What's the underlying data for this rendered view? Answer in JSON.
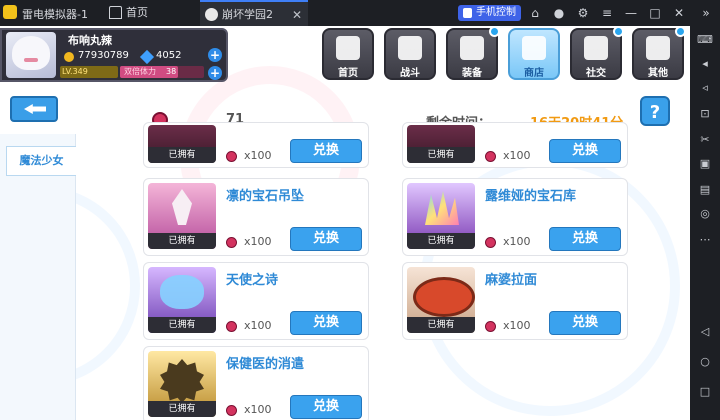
{
  "emulator": {
    "app_title": "雷电模拟器-1",
    "tabs": [
      {
        "label": "首页"
      },
      {
        "label": "崩坏学园2"
      }
    ],
    "phone_control": "手机控制"
  },
  "player": {
    "name": "布响丸辣",
    "coins": "77930789",
    "gems": "4052",
    "level": "LV.349",
    "stamina_label": "双倍体力",
    "stamina_value": "38"
  },
  "nav": [
    {
      "label": "首页",
      "icon": "house-icon"
    },
    {
      "label": "战斗",
      "icon": "swords-icon"
    },
    {
      "label": "装备",
      "icon": "star-icon"
    },
    {
      "label": "商店",
      "icon": "basket-icon",
      "active": true
    },
    {
      "label": "社交",
      "icon": "face-icon"
    },
    {
      "label": "其他",
      "icon": "target-icon"
    }
  ],
  "shop": {
    "currency_count": "71",
    "time_label": "剩余时间：",
    "time_value": "16天20时41分",
    "help": "?",
    "category": "魔法少女"
  },
  "items": [
    {
      "name": "",
      "owned": "已拥有",
      "price": "x100",
      "button": "兑换"
    },
    {
      "name": "",
      "owned": "已拥有",
      "price": "x100",
      "button": "兑换"
    },
    {
      "name": "凛的宝石吊坠",
      "owned": "已拥有",
      "price": "x100",
      "button": "兑换"
    },
    {
      "name": "露维娅的宝石库",
      "owned": "已拥有",
      "price": "x100",
      "button": "兑换"
    },
    {
      "name": "天使之诗",
      "owned": "已拥有",
      "price": "x100",
      "button": "兑换"
    },
    {
      "name": "麻婆拉面",
      "owned": "已拥有",
      "price": "x100",
      "button": "兑换"
    },
    {
      "name": "保健医的消遣",
      "owned": "已拥有",
      "price": "x100",
      "button": "兑换"
    }
  ],
  "colors": {
    "accent": "#3aa2ee",
    "timer": "#f19a12",
    "title_bar": "#1d1f24"
  }
}
